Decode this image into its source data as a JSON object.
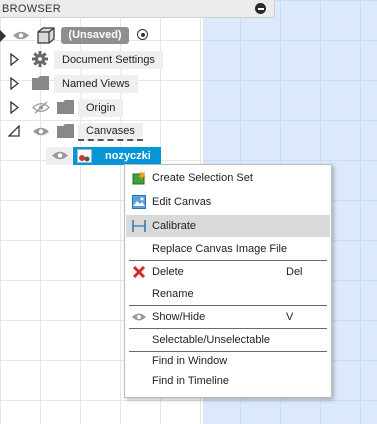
{
  "browser": {
    "title": "BROWSER"
  },
  "tree": {
    "root": "(Unsaved)",
    "items": [
      {
        "label": "Document Settings",
        "icon": "gear-icon"
      },
      {
        "label": "Named Views",
        "icon": "folder-icon"
      },
      {
        "label": "Origin",
        "icon": "folder-icon",
        "visibility": "hidden"
      },
      {
        "label": "Canvases",
        "icon": "folder-icon",
        "expanded": true
      },
      {
        "label": "nozyczki",
        "icon": "canvas-image-icon",
        "selected": true
      }
    ]
  },
  "context_menu": {
    "items": [
      {
        "label": "Create Selection Set",
        "shortcut": "",
        "icon": "selection-set-icon"
      },
      {
        "label": "Edit Canvas",
        "shortcut": "",
        "icon": "canvas-icon"
      },
      {
        "label": "Calibrate",
        "shortcut": "",
        "icon": "calibrate-icon",
        "highlighted": true
      },
      {
        "label": "Replace Canvas Image File",
        "shortcut": "",
        "icon": ""
      },
      {
        "label": "Delete",
        "shortcut": "Del",
        "icon": "delete-x-icon"
      },
      {
        "label": "Rename",
        "shortcut": "",
        "icon": ""
      },
      {
        "label": "Show/Hide",
        "shortcut": "V",
        "icon": "eye-icon"
      },
      {
        "label": "Selectable/Unselectable",
        "shortcut": "",
        "icon": ""
      },
      {
        "label": "Find in Window",
        "shortcut": "",
        "icon": ""
      },
      {
        "label": "Find in Timeline",
        "shortcut": "",
        "icon": ""
      }
    ]
  },
  "colors": {
    "selection": "#0696d7",
    "canvas_blue": "#dce9fb",
    "highlight": "#d9d9d9",
    "delete_red": "#d9262c"
  }
}
